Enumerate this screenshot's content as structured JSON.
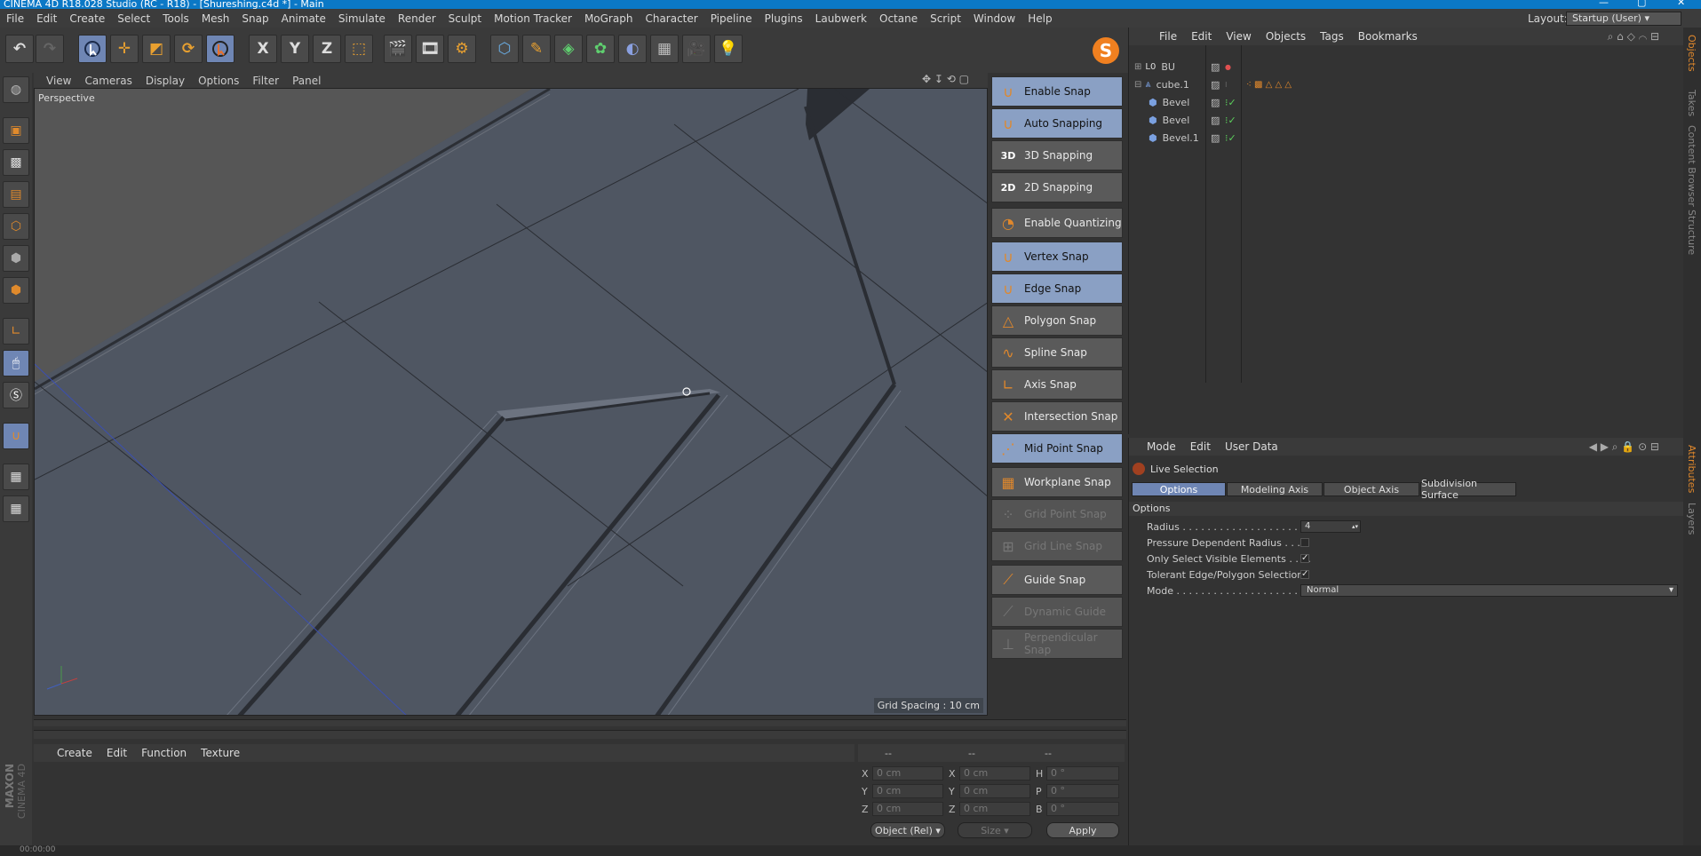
{
  "titlebar": {
    "text": "CINEMA 4D R18.028 Studio (RC - R18) - [Shureshing.c4d *] - Main",
    "min": "—",
    "max": "▢",
    "close": "✕"
  },
  "menu": [
    "File",
    "Edit",
    "Create",
    "Select",
    "Tools",
    "Mesh",
    "Snap",
    "Animate",
    "Simulate",
    "Render",
    "Sculpt",
    "Motion Tracker",
    "MoGraph",
    "Character",
    "Pipeline",
    "Plugins",
    "Laubwerk",
    "Octane",
    "Script",
    "Window",
    "Help"
  ],
  "layout": {
    "label": "Layout:",
    "value": "Startup (User)"
  },
  "toolbar": {
    "x": "X",
    "y": "Y",
    "z": "Z"
  },
  "viewport": {
    "menu": [
      "View",
      "Cameras",
      "Display",
      "Options",
      "Filter",
      "Panel"
    ],
    "label": "Perspective",
    "grid": "Grid Spacing : 10 cm"
  },
  "snap": {
    "items": [
      {
        "label": "Enable Snap",
        "state": "on",
        "icon": "magnet-icon"
      },
      {
        "label": "Auto Snapping",
        "state": "on",
        "icon": "auto-snap-icon"
      },
      {
        "label": "3D Snapping",
        "state": "off",
        "icon": "3d-snap-icon",
        "badge": "3D"
      },
      {
        "label": "2D Snapping",
        "state": "off",
        "icon": "2d-snap-icon",
        "badge": "2D"
      },
      {
        "label": "Enable Quantizing",
        "state": "off",
        "icon": "quantize-icon"
      },
      {
        "label": "Vertex Snap",
        "state": "on",
        "icon": "vertex-snap-icon"
      },
      {
        "label": "Edge Snap",
        "state": "on",
        "icon": "edge-snap-icon"
      },
      {
        "label": "Polygon Snap",
        "state": "off",
        "icon": "polygon-snap-icon"
      },
      {
        "label": "Spline Snap",
        "state": "off",
        "icon": "spline-snap-icon"
      },
      {
        "label": "Axis Snap",
        "state": "off",
        "icon": "axis-snap-icon"
      },
      {
        "label": "Intersection Snap",
        "state": "off",
        "icon": "intersection-snap-icon"
      },
      {
        "label": "Mid Point Snap",
        "state": "on",
        "icon": "midpoint-snap-icon"
      },
      {
        "label": "Workplane Snap",
        "state": "off",
        "icon": "workplane-snap-icon"
      },
      {
        "label": "Grid Point Snap",
        "state": "dis",
        "icon": "grid-point-snap-icon"
      },
      {
        "label": "Grid Line Snap",
        "state": "dis",
        "icon": "grid-line-snap-icon"
      },
      {
        "label": "Guide Snap",
        "state": "off",
        "icon": "guide-snap-icon"
      },
      {
        "label": "Dynamic Guide",
        "state": "dis",
        "icon": "dynamic-guide-icon"
      },
      {
        "label": "Perpendicular Snap",
        "state": "dis",
        "icon": "perpendicular-snap-icon"
      }
    ]
  },
  "objects": {
    "menu": [
      "File",
      "Edit",
      "View",
      "Objects",
      "Tags",
      "Bookmarks"
    ],
    "rows": [
      {
        "name": "BU",
        "indent": 0,
        "prefix": "L0"
      },
      {
        "name": "cube.1",
        "indent": 0
      },
      {
        "name": "Bevel",
        "indent": 1
      },
      {
        "name": "Bevel",
        "indent": 1
      },
      {
        "name": "Bevel.1",
        "indent": 1
      }
    ]
  },
  "attributes": {
    "menu": [
      "Mode",
      "Edit",
      "User Data"
    ],
    "tool": "Live Selection",
    "tabs": [
      "Options",
      "Modeling Axis",
      "Object Axis",
      "Subdivision Surface"
    ],
    "section": "Options",
    "radius_label": "Radius . . . . . . . . . . . . . . . . . . . . . . .",
    "radius_value": "4",
    "pressure_label": "Pressure Dependent Radius . . . .",
    "visible_label": "Only Select Visible Elements . . . .",
    "tolerant_label": "Tolerant Edge/Polygon Selection",
    "mode_label": "Mode . . . . . . . . . . . . . . . . . . . . . . . . .",
    "mode_value": "Normal",
    "check": "✓"
  },
  "rightstrip": [
    "Objects",
    "Takes",
    "Content Browser",
    "Structure",
    "Attributes",
    "Layers"
  ],
  "material": {
    "menu": [
      "Create",
      "Edit",
      "Function",
      "Texture"
    ]
  },
  "coords": {
    "head": [
      "--",
      "--",
      "--"
    ],
    "labels": [
      "X",
      "Y",
      "Z",
      "X",
      "Y",
      "Z",
      "H",
      "P",
      "B"
    ],
    "values": [
      "0 cm",
      "0 cm",
      "0 cm",
      "0 cm",
      "0 cm",
      "0 cm",
      "0 °",
      "0 °",
      "0 °"
    ],
    "mode": "Object (Rel)",
    "size": "Size",
    "apply": "Apply"
  },
  "status": "00:00:00",
  "brand": {
    "maxon": "MAXON",
    "c4d": "CINEMA 4D"
  }
}
